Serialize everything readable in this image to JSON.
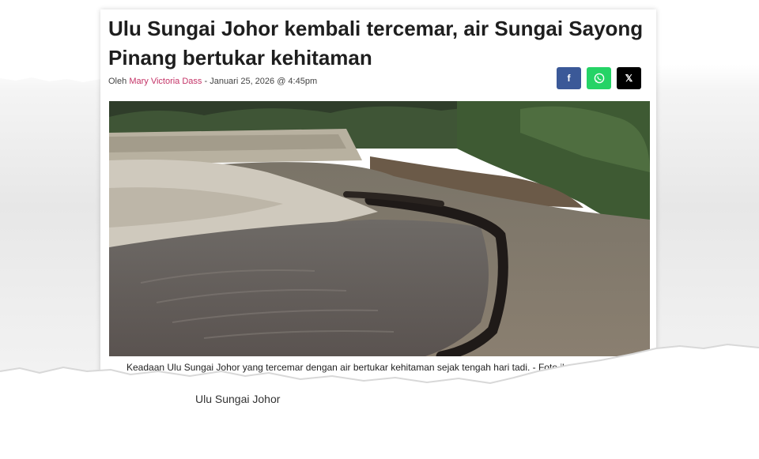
{
  "article": {
    "headline": "Ulu Sungai Johor kembali tercemar, air Sungai Sayong Pinang bertukar kehitaman",
    "byline_prefix": "Oleh",
    "author": "Mary Victoria Dass",
    "date_separator": " - ",
    "date": "Januari 25, 2026 @ 4:45pm",
    "caption": "Keadaan Ulu Sungai Johor yang tercemar dengan air bertukar kehitaman sejak tengah hari tadi. - Foto ihsan p",
    "body_fragment": "Ulu Sungai Johor"
  },
  "share_buttons": [
    {
      "label": "f",
      "icon": "facebook-icon",
      "color": "#3b5998"
    },
    {
      "label": "whatsapp",
      "icon": "whatsapp-icon",
      "color": "#25d366"
    },
    {
      "label": "𝕏",
      "icon": "x-icon",
      "color": "#000000"
    }
  ],
  "colors": {
    "author_link": "#c43367",
    "headline": "#1e1e1e"
  }
}
